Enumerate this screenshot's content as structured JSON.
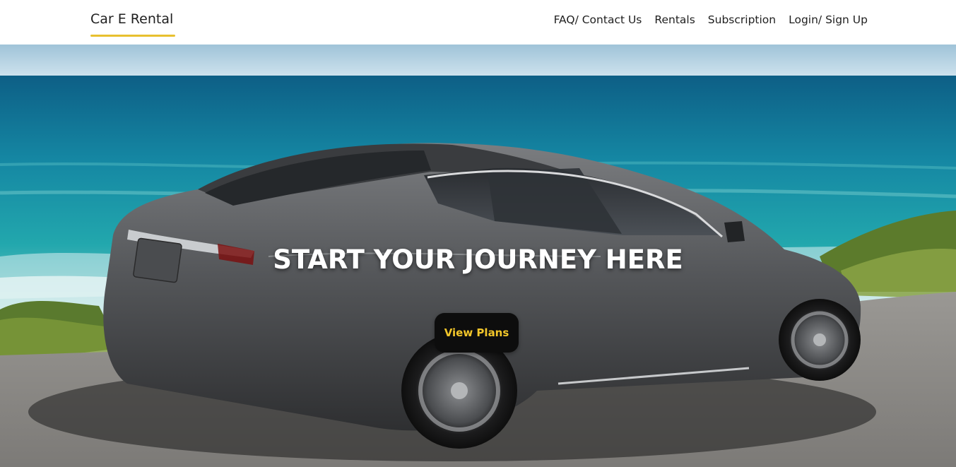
{
  "brand": {
    "name": "Car E Rental",
    "accent_color": "#e8c02f"
  },
  "nav": {
    "items": [
      {
        "label": "FAQ/ Contact Us"
      },
      {
        "label": "Rentals"
      },
      {
        "label": "Subscription"
      },
      {
        "label": "Login/ Sign Up"
      }
    ]
  },
  "hero": {
    "headline": "START YOUR JOURNEY HERE",
    "cta_label": "View Plans",
    "cta_text_color": "#f2c62a",
    "cta_background": "#0d0d0d"
  }
}
